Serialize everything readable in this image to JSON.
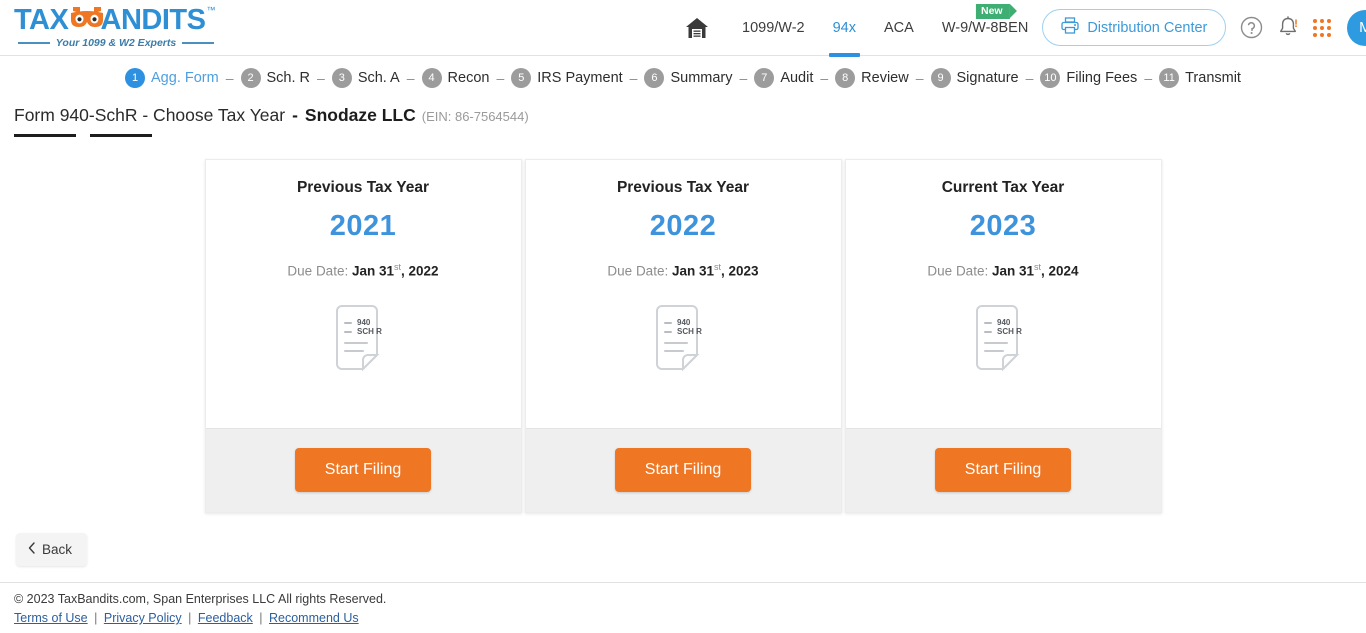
{
  "brand": {
    "logo_text_1": "TAX",
    "logo_text_2": "ANDITS",
    "logo_tm": "™",
    "tagline": "Your 1099 & W2 Experts",
    "accent_blue": "#2e8fd4",
    "accent_orange": "#ef7622"
  },
  "header": {
    "home_icon": "home-icon",
    "nav": [
      {
        "label": "1099/W-2",
        "active": false,
        "badge": null
      },
      {
        "label": "94x",
        "active": true,
        "badge": null
      },
      {
        "label": "ACA",
        "active": false,
        "badge": null
      },
      {
        "label": "W-9/W-8BEN",
        "active": false,
        "badge": "New"
      }
    ],
    "distribution_center": "Distribution Center",
    "printer_icon": "printer-icon",
    "help_icon": "help-circle-icon",
    "bell_icon": "bell-icon",
    "apps_icon": "grid-apps-icon",
    "avatar_initial": "M"
  },
  "steps": [
    {
      "num": "1",
      "label": "Agg. Form",
      "active": true
    },
    {
      "num": "2",
      "label": "Sch. R",
      "active": false
    },
    {
      "num": "3",
      "label": "Sch. A",
      "active": false
    },
    {
      "num": "4",
      "label": "Recon",
      "active": false
    },
    {
      "num": "5",
      "label": "IRS Payment",
      "active": false
    },
    {
      "num": "6",
      "label": "Summary",
      "active": false
    },
    {
      "num": "7",
      "label": "Audit",
      "active": false
    },
    {
      "num": "8",
      "label": "Review",
      "active": false
    },
    {
      "num": "9",
      "label": "Signature",
      "active": false
    },
    {
      "num": "10",
      "label": "Filing Fees",
      "active": false
    },
    {
      "num": "11",
      "label": "Transmit",
      "active": false
    }
  ],
  "step_separator": "–",
  "page": {
    "title": "Form 940-SchR - Choose Tax Year",
    "company_prefix": "-",
    "company": "Snodaze LLC",
    "ein": "(EIN: 86-7564544)"
  },
  "cards": [
    {
      "heading": "Previous Tax Year",
      "year": "2021",
      "due_label": "Due Date:",
      "due_month_day": "Jan 31",
      "due_ordinal": "st",
      "due_year": ", 2022",
      "doc_line1": "940",
      "doc_line2": "SCH R",
      "button": "Start Filing"
    },
    {
      "heading": "Previous Tax Year",
      "year": "2022",
      "due_label": "Due Date:",
      "due_month_day": "Jan 31",
      "due_ordinal": "st",
      "due_year": ", 2023",
      "doc_line1": "940",
      "doc_line2": "SCH R",
      "button": "Start Filing"
    },
    {
      "heading": "Current Tax Year",
      "year": "2023",
      "due_label": "Due Date:",
      "due_month_day": "Jan 31",
      "due_ordinal": "st",
      "due_year": ", 2024",
      "doc_line1": "940",
      "doc_line2": "SCH R",
      "button": "Start Filing"
    }
  ],
  "back_button": {
    "icon": "chevron-left-icon",
    "label": "Back"
  },
  "footer": {
    "copyright": "© 2023 TaxBandits.com, Span Enterprises LLC All rights Reserved.",
    "links": [
      "Terms of Use",
      "Privacy Policy",
      "Feedback",
      "Recommend Us"
    ],
    "separator": "|"
  }
}
